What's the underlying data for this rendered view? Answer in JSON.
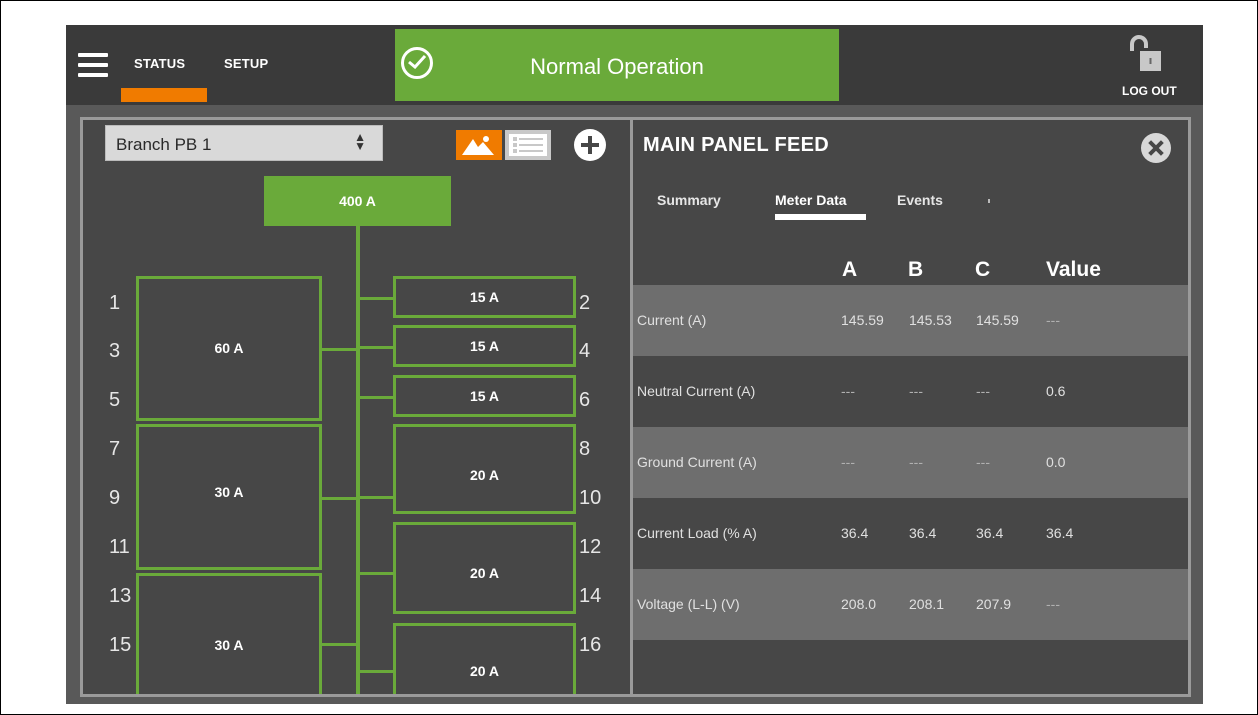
{
  "header": {
    "nav_tabs": [
      {
        "label": "STATUS"
      },
      {
        "label": "SETUP"
      }
    ],
    "status_text": "Normal Operation",
    "logout_label": "LOG OUT",
    "accent_color": "#f07b00",
    "status_color": "#6aaa3a"
  },
  "left": {
    "branch_select_value": "Branch PB 1",
    "main_breaker": "400 A",
    "breakers": [
      {
        "rating": "60 A"
      },
      {
        "rating": "30 A"
      },
      {
        "rating": "30 A"
      },
      {
        "rating": "15 A"
      },
      {
        "rating": "15 A"
      },
      {
        "rating": "15 A"
      },
      {
        "rating": "20 A"
      },
      {
        "rating": "20 A"
      },
      {
        "rating": "20 A"
      }
    ],
    "left_numbers": [
      "1",
      "3",
      "5",
      "7",
      "9",
      "11",
      "13",
      "15"
    ],
    "right_numbers": [
      "2",
      "4",
      "6",
      "8",
      "10",
      "12",
      "14",
      "16"
    ]
  },
  "detail": {
    "title": "MAIN PANEL FEED",
    "tabs": [
      {
        "label": "Summary"
      },
      {
        "label": "Meter Data"
      },
      {
        "label": "Events"
      }
    ],
    "active_tab": "Meter Data",
    "columns": [
      "A",
      "B",
      "C",
      "Value"
    ],
    "rows": [
      {
        "label": "Current (A)",
        "a": "145.59",
        "b": "145.53",
        "c": "145.59",
        "value": "---"
      },
      {
        "label": "Neutral Current (A)",
        "a": "---",
        "b": "---",
        "c": "---",
        "value": "0.6"
      },
      {
        "label": "Ground Current (A)",
        "a": "---",
        "b": "---",
        "c": "---",
        "value": "0.0"
      },
      {
        "label": "Current Load (% A)",
        "a": "36.4",
        "b": "36.4",
        "c": "36.4",
        "value": "36.4"
      },
      {
        "label": "Voltage (L-L) (V)",
        "a": "208.0",
        "b": "208.1",
        "c": "207.9",
        "value": "---"
      }
    ]
  }
}
